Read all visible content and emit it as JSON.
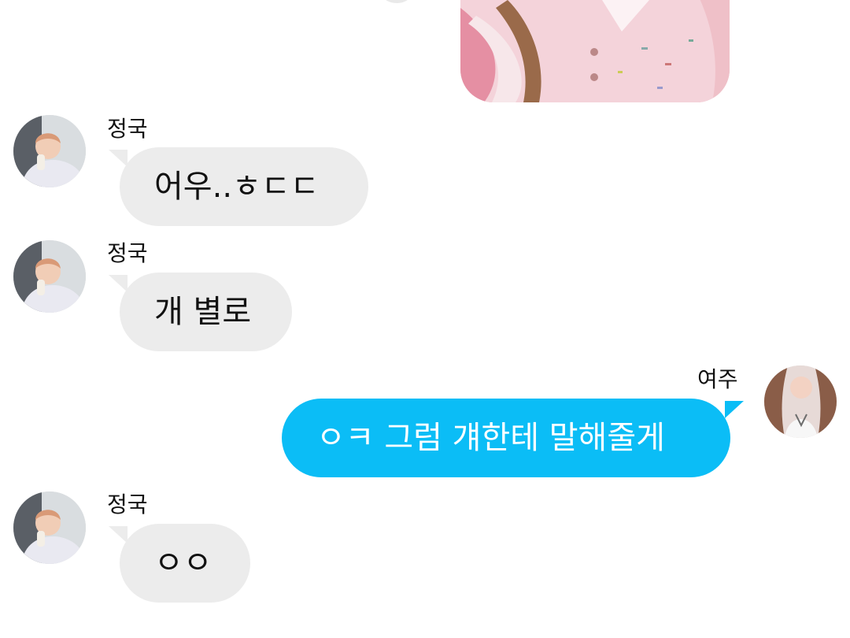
{
  "conversation": {
    "shared_image": {
      "description_icon": "photo-thumbnail"
    },
    "messages": [
      {
        "sender": "정국",
        "text": "어우..ㅎㄷㄷ",
        "direction": "incoming"
      },
      {
        "sender": "정국",
        "text": "개 별로",
        "direction": "incoming"
      },
      {
        "sender": "여주",
        "text": "ㅇㅋ 그럼 걔한테 말해줄게",
        "direction": "outgoing"
      },
      {
        "sender": "정국",
        "text": "ㅇㅇ",
        "direction": "incoming"
      }
    ]
  },
  "colors": {
    "incoming_bubble": "#ececec",
    "outgoing_bubble": "#0bbdf6",
    "outgoing_text": "#ffffff",
    "incoming_text": "#111111"
  }
}
